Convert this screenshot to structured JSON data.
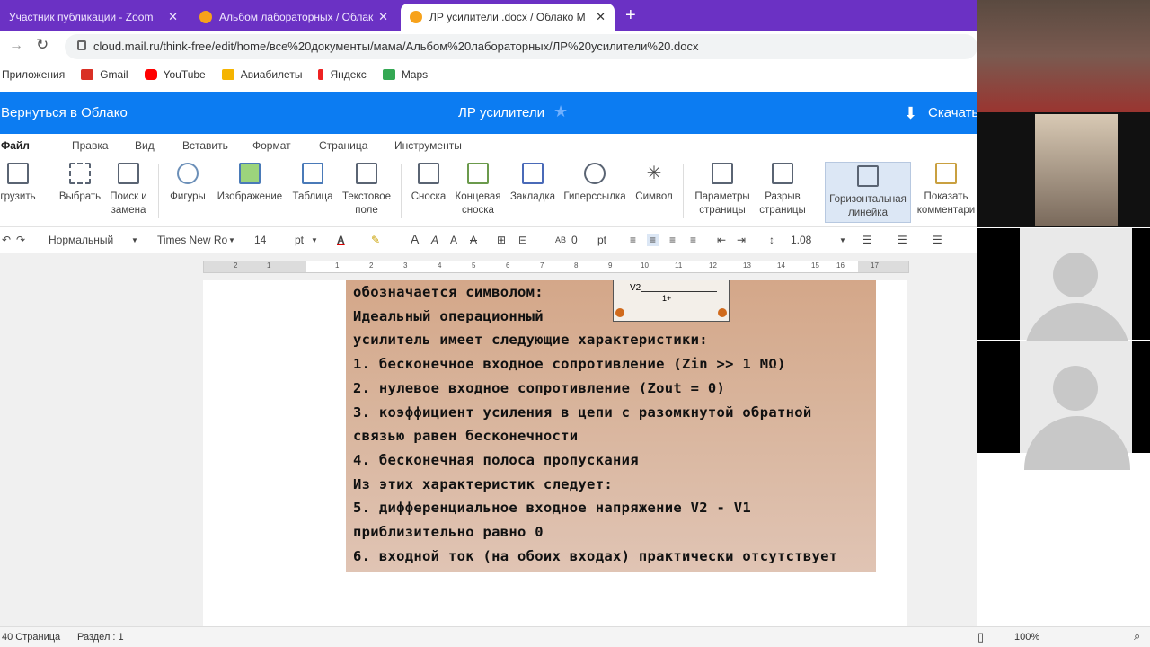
{
  "browser": {
    "tabs": [
      {
        "title": "Участник публикации - Zoom",
        "close": "✕"
      },
      {
        "title": "Альбом лабораторных / Облак",
        "close": "✕"
      },
      {
        "title": "ЛР усилители .docx / Облако М",
        "close": "✕"
      }
    ],
    "new_tab": "+",
    "url": "cloud.mail.ru/think-free/edit/home/все%20документы/мама/Альбом%20лабораторных/ЛР%20усилители%20.docx",
    "bookmarks": [
      "Приложения",
      "Gmail",
      "YouTube",
      "Авиабилеты",
      "Яндекс",
      "Maps"
    ]
  },
  "app": {
    "back_label": "Вернуться в Облако",
    "doc_title": "ЛР усилители",
    "download_label": "Скачать",
    "menu": [
      "Файл",
      "Правка",
      "Вид",
      "Вставить",
      "Формат",
      "Страница",
      "Инструменты"
    ],
    "ribbon": [
      {
        "label": "грузить"
      },
      {
        "label": "Выбрать"
      },
      {
        "label": "Поиск и замена"
      },
      {
        "label": "Фигуры"
      },
      {
        "label": "Изображение"
      },
      {
        "label": "Таблица"
      },
      {
        "label": "Текстовое поле"
      },
      {
        "label": "Сноска"
      },
      {
        "label": "Концевая сноска"
      },
      {
        "label": "Закладка"
      },
      {
        "label": "Гиперссылка"
      },
      {
        "label": "Символ"
      },
      {
        "label": "Параметры страницы"
      },
      {
        "label": "Разрыв страницы"
      },
      {
        "label": "Горизонтальная линейка"
      },
      {
        "label": "Показать комментари"
      }
    ],
    "format": {
      "style": "Нормальный",
      "font": "Times New Ro",
      "size": "14",
      "unit": "pt",
      "spacing_value": "0",
      "spacing_unit": "pt",
      "line_spacing": "1.08"
    },
    "ruler_numbers": [
      "2",
      "1",
      "1",
      "2",
      "3",
      "4",
      "5",
      "6",
      "7",
      "8",
      "9",
      "10",
      "11",
      "12",
      "13",
      "14",
      "15",
      "16",
      "17"
    ]
  },
  "document": {
    "lines": [
      "обозначается символом:",
      "Идеальный операционный",
      "усилитель имеет следующие характеристики:",
      "1. бесконечное входное сопротивление (Zin >> 1 MΩ)",
      "2. нулевое входное сопротивление (Zout = 0)",
      "3. коэффициент усиления в цепи с разомкнутой обратной",
      "связью равен бесконечности",
      "4. бесконечная полоса пропускания",
      "Из этих характеристик следует:",
      "5. дифференциальное входное напряжение V2 - V1",
      "приблизительно равно 0",
      "6. входной ток (на обоих входах) практически отсутствует"
    ],
    "schematic_labels": [
      "V2",
      "1+"
    ]
  },
  "status": {
    "pages": "40 Страница",
    "section": "Раздел : 1",
    "zoom": "100%"
  }
}
